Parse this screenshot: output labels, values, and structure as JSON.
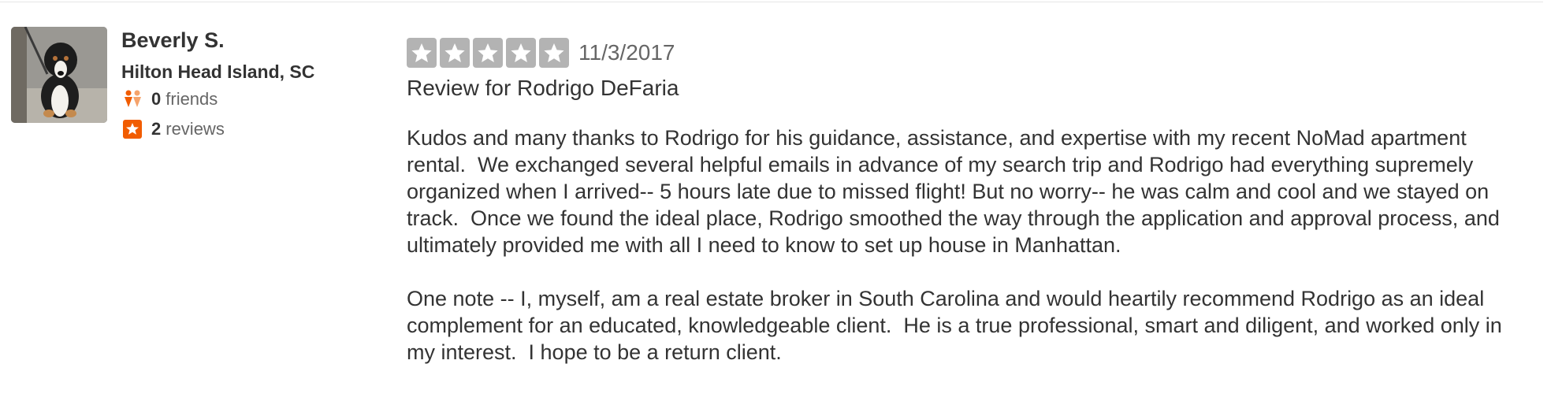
{
  "reviewer": {
    "name": "Beverly S.",
    "location": "Hilton Head Island, SC",
    "avatar_icon": "dog-photo-avatar",
    "friends_count": "0",
    "friends_label": "friends",
    "friends_icon": "friends-icon",
    "reviews_count": "2",
    "reviews_label": "reviews",
    "reviews_icon": "review-star-icon"
  },
  "review": {
    "rating": 5,
    "rating_max": 5,
    "date": "11/3/2017",
    "review_for": "Review for Rodrigo DeFaria",
    "paragraphs": [
      "Kudos and many thanks to Rodrigo for his guidance, assistance, and expertise with my recent NoMad apartment rental.  We exchanged several helpful emails in advance of my search trip and Rodrigo had everything supremely organized when I arrived-- 5 hours late due to missed flight! But no worry-- he was calm and cool and we stayed on track.  Once we found the ideal place, Rodrigo smoothed the way through the application and approval process, and ultimately provided me with all I need to know to set up house in Manhattan.",
      "One note -- I, myself, am a real estate broker in South Carolina and would heartily recommend Rodrigo as an ideal complement for an educated, knowledgeable client.  He is a true professional, smart and diligent, and worked only in my interest.  I hope to be a return client."
    ]
  },
  "colors": {
    "star_fill": "#b3b3b3",
    "accent_orange": "#f15c00",
    "text": "#333333",
    "muted_text": "#666666"
  }
}
